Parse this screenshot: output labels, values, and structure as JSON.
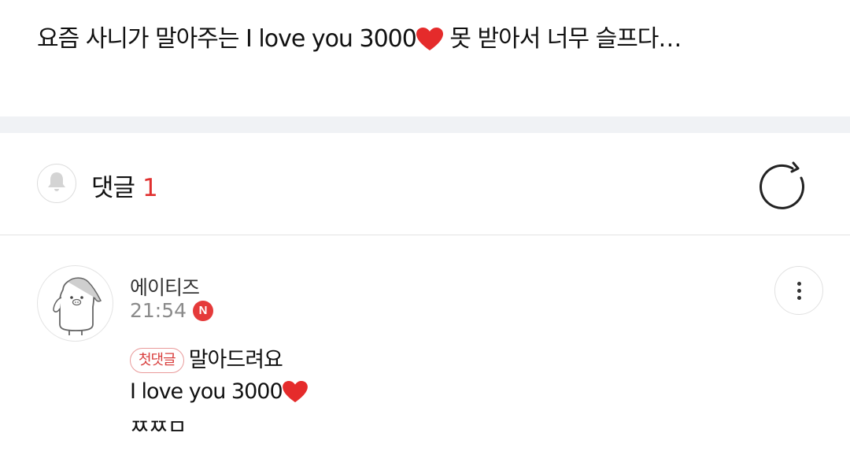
{
  "post": {
    "text_before": "요즘 사니가 말아주는 I love you 3000",
    "text_after": " 못 받아서 너무 슬프다…",
    "emoji_icon": "heart-icon"
  },
  "comments_header": {
    "title": "댓글",
    "count": "1",
    "bell_icon": "bell-icon",
    "refresh_icon": "refresh-icon"
  },
  "comment": {
    "author": "에이티즈",
    "time": "21:54",
    "new_badge": "N",
    "first_badge": "첫댓글",
    "line1": "말아드려요",
    "line2": "I love you 3000",
    "line3": "ㅉㅉㅁ",
    "more_icon": "more-vertical-icon"
  },
  "colors": {
    "accent_red": "#e0302f",
    "heart_red": "#e52b2b",
    "badge_red": "#e53a3a",
    "separator_band": "#f0f2f5"
  }
}
